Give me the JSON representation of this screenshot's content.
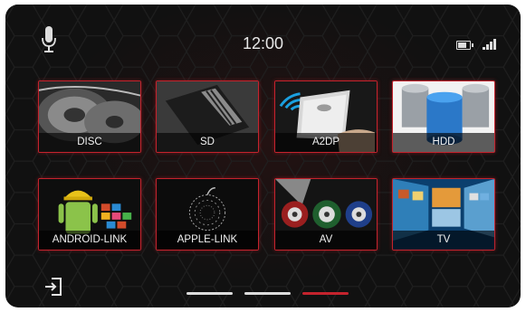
{
  "status": {
    "time": "12:00",
    "mic_icon": "microphone-icon",
    "battery_icon": "battery-icon",
    "signal_icon": "signal-icon"
  },
  "tiles": [
    {
      "label": "DISC",
      "icon": "disc-icon"
    },
    {
      "label": "SD",
      "icon": "sd-card-icon"
    },
    {
      "label": "A2DP",
      "icon": "bluetooth-audio-icon"
    },
    {
      "label": "HDD",
      "icon": "hard-drive-icon"
    },
    {
      "label": "ANDROID-LINK",
      "icon": "android-icon"
    },
    {
      "label": "APPLE-LINK",
      "icon": "apple-icon"
    },
    {
      "label": "AV",
      "icon": "rca-cable-icon"
    },
    {
      "label": "TV",
      "icon": "tv-icon"
    }
  ],
  "exit": {
    "icon": "exit-icon"
  },
  "pager": {
    "pages": 3,
    "active_index": 2
  },
  "colors": {
    "accent": "#c4232d",
    "inactive_page": "#dcdcdc",
    "background": "#111111"
  }
}
